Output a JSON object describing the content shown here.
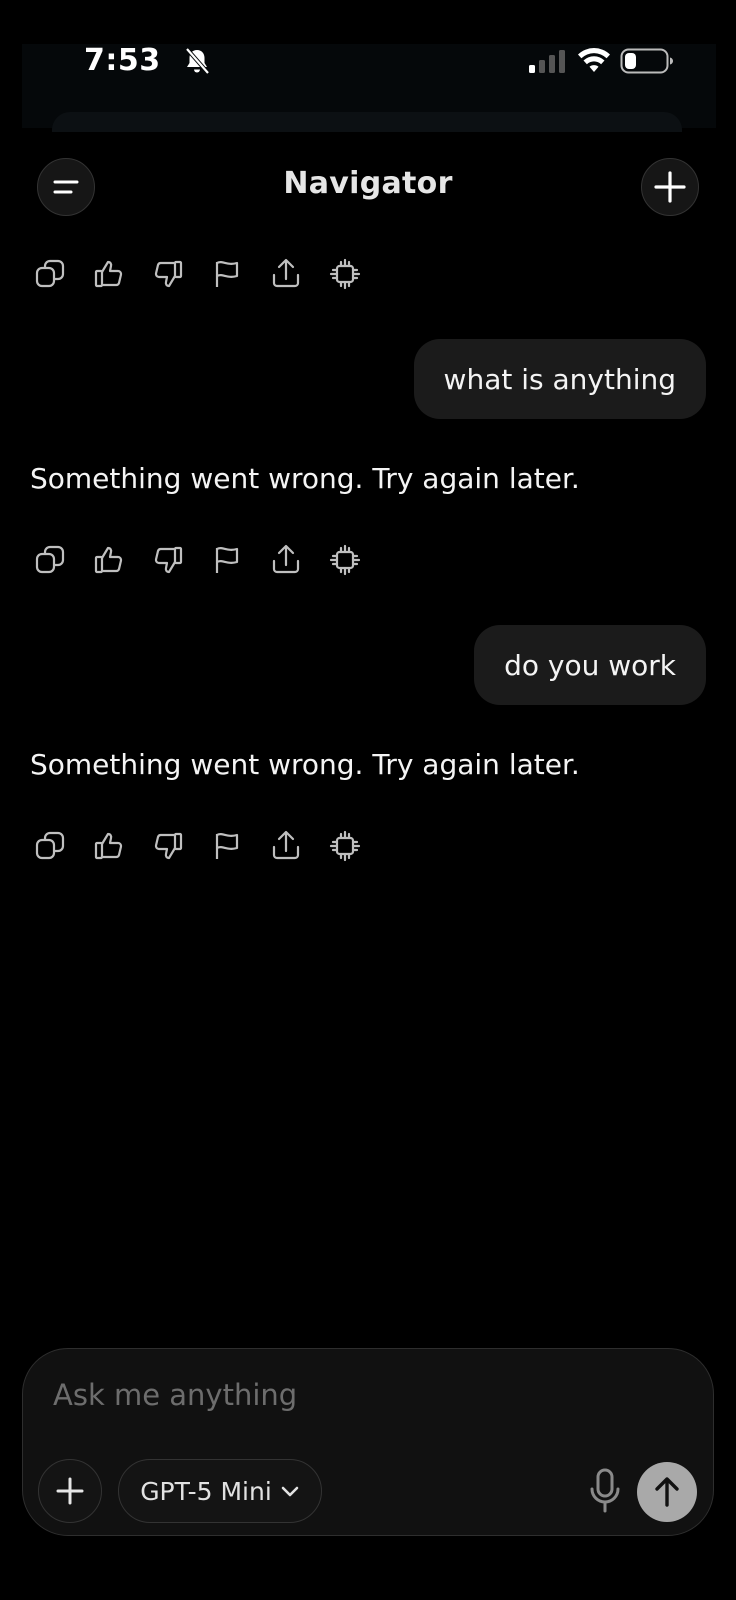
{
  "status_bar": {
    "time": "7:53",
    "icons": [
      "bell-off-icon",
      "signal-icon",
      "wifi-icon",
      "battery-icon"
    ]
  },
  "header": {
    "title": "Navigator",
    "left_icon": "menu-icon",
    "right_icon": "plus-icon"
  },
  "messages": [
    {
      "role": "assistant",
      "text": "",
      "actions": [
        "copy",
        "thumbs-up",
        "thumbs-down",
        "flag",
        "share",
        "chip"
      ]
    },
    {
      "role": "user",
      "text": "what is anything"
    },
    {
      "role": "assistant",
      "text": "Something went wrong. Try again later.",
      "actions": [
        "copy",
        "thumbs-up",
        "thumbs-down",
        "flag",
        "share",
        "chip"
      ]
    },
    {
      "role": "user",
      "text": "do you work"
    },
    {
      "role": "assistant",
      "text": "Something went wrong. Try again later.",
      "actions": [
        "copy",
        "thumbs-up",
        "thumbs-down",
        "flag",
        "share",
        "chip"
      ]
    }
  ],
  "composer": {
    "placeholder": "Ask me anything",
    "value": "",
    "model": "GPT-5 Mini"
  },
  "colors": {
    "background": "#000000",
    "bubble": "#1b1b1b",
    "send_button": "#a9a9a9"
  }
}
